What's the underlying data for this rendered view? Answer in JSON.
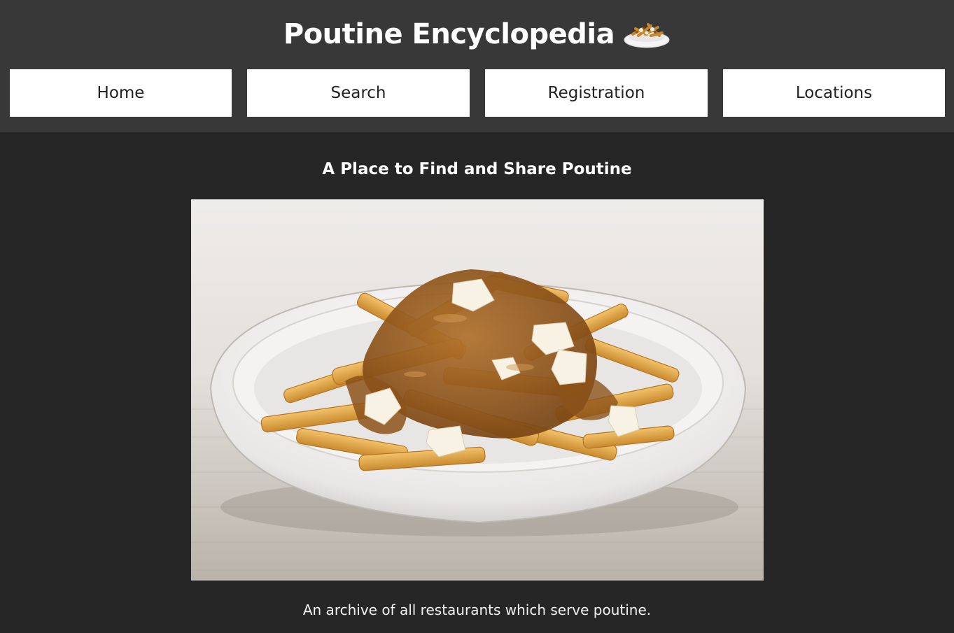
{
  "header": {
    "title": "Poutine Encyclopedia",
    "logo_icon": "poutine-bowl-icon"
  },
  "nav": {
    "items": [
      {
        "label": "Home"
      },
      {
        "label": "Search"
      },
      {
        "label": "Registration"
      },
      {
        "label": "Locations"
      }
    ]
  },
  "main": {
    "tagline": "A Place to Find and Share Poutine",
    "hero_image": "poutine-photo",
    "description": "An archive of all restaurants which serve poutine."
  },
  "colors": {
    "header_bg": "#383838",
    "page_bg": "#262626",
    "nav_button_bg": "#ffffff",
    "gravy": "#9a5a1a",
    "fries": "#e0a44a"
  }
}
